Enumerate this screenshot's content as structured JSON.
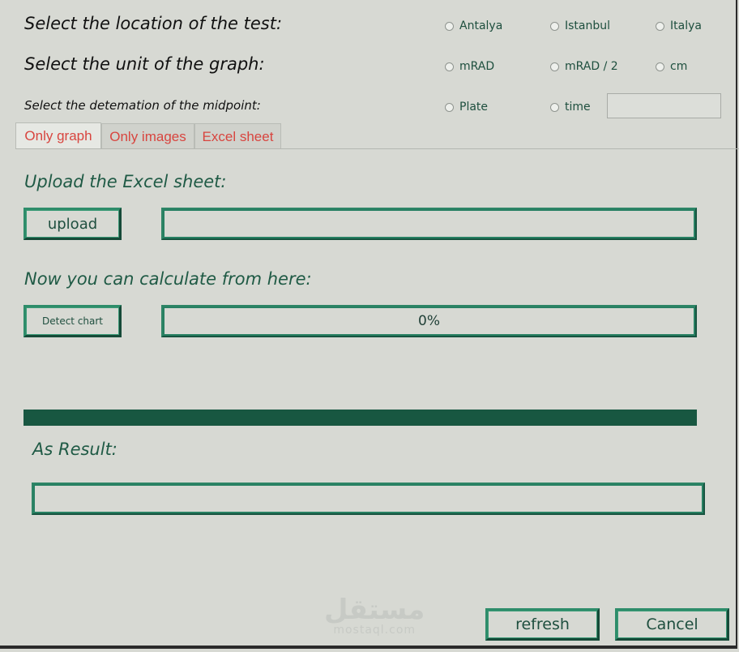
{
  "labels": {
    "location": "Select the location of the test:",
    "unit": "Select the unit of the graph:",
    "midpoint": "Select the detemation of the midpoint:"
  },
  "location_options": [
    "Antalya",
    "Istanbul",
    "Italya"
  ],
  "unit_options": [
    "mRAD",
    "mRAD / 2",
    "cm"
  ],
  "midpoint_options": [
    "Plate",
    "time"
  ],
  "midpoint_time_value": "",
  "tabs": [
    "Only graph",
    "Only images",
    "Excel sheet"
  ],
  "active_tab": "Only graph",
  "upload_section": {
    "title": "Upload the Excel sheet:",
    "button": "upload",
    "path_value": ""
  },
  "calc_section": {
    "title": "Now you can calculate from here:",
    "button": "Detect chart",
    "progress_text": "0%",
    "progress": 0
  },
  "result_section": {
    "title": "As Result:",
    "value": ""
  },
  "footer": {
    "refresh": "refresh",
    "cancel": "Cancel"
  },
  "watermark": {
    "arabic": "مستقل",
    "latin": "mostaql.com"
  },
  "colors": {
    "background": "#d7d9d3",
    "accent_green": "#185741",
    "tab_text": "#d8453f"
  }
}
